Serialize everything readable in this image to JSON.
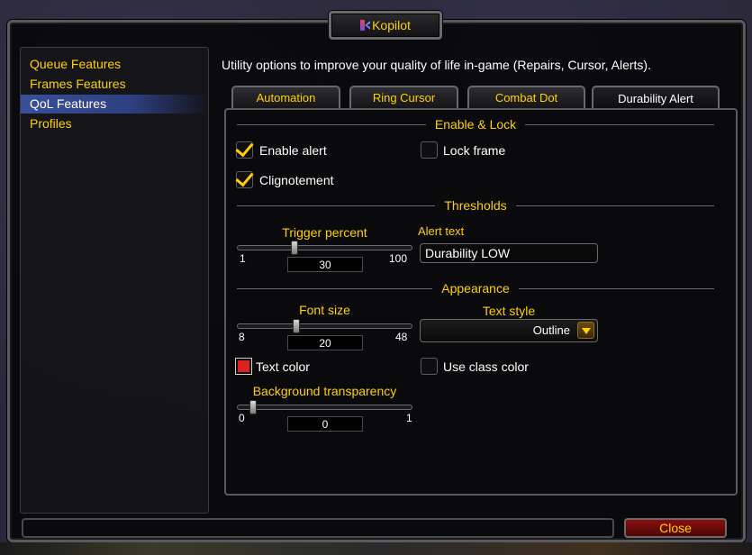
{
  "window": {
    "title": "Kopilot",
    "logo_icon": "kopilot-logo-icon",
    "description": "Utility options to improve your quality of life in-game (Repairs, Cursor, Alerts)."
  },
  "sidebar": {
    "items": [
      {
        "label": "Queue Features",
        "active": false
      },
      {
        "label": "Frames Features",
        "active": false
      },
      {
        "label": "QoL Features",
        "active": true
      },
      {
        "label": "Profiles",
        "active": false
      }
    ]
  },
  "tabs": [
    {
      "label": "Automation",
      "active": false
    },
    {
      "label": "Ring Cursor",
      "active": false
    },
    {
      "label": "Combat Dot",
      "active": false
    },
    {
      "label": "Durability Alert",
      "active": true
    }
  ],
  "sections": {
    "enable_lock": "Enable & Lock",
    "thresholds": "Thresholds",
    "appearance": "Appearance"
  },
  "checkboxes": {
    "enable_alert": {
      "label": "Enable alert",
      "checked": true
    },
    "lock_frame": {
      "label": "Lock frame",
      "checked": false
    },
    "clignotement": {
      "label": "Clignotement",
      "checked": true
    },
    "use_class_color": {
      "label": "Use class color",
      "checked": false
    }
  },
  "sliders": {
    "trigger_percent": {
      "title": "Trigger percent",
      "min": "1",
      "max": "100",
      "value": "30"
    },
    "font_size": {
      "title": "Font size",
      "min": "8",
      "max": "48",
      "value": "20"
    },
    "background_transparency": {
      "title": "Background transparency",
      "min": "0",
      "max": "1",
      "value": "0"
    }
  },
  "alert_text": {
    "label": "Alert text",
    "value": "Durability LOW"
  },
  "text_style": {
    "label": "Text style",
    "value": "Outline"
  },
  "text_color": {
    "label": "Text color",
    "color": "#e02020"
  },
  "footer": {
    "close_label": "Close"
  },
  "colors": {
    "accent": "#ffd100",
    "active_item": "#3a4f9a",
    "close_button": "#8a0e0e"
  }
}
